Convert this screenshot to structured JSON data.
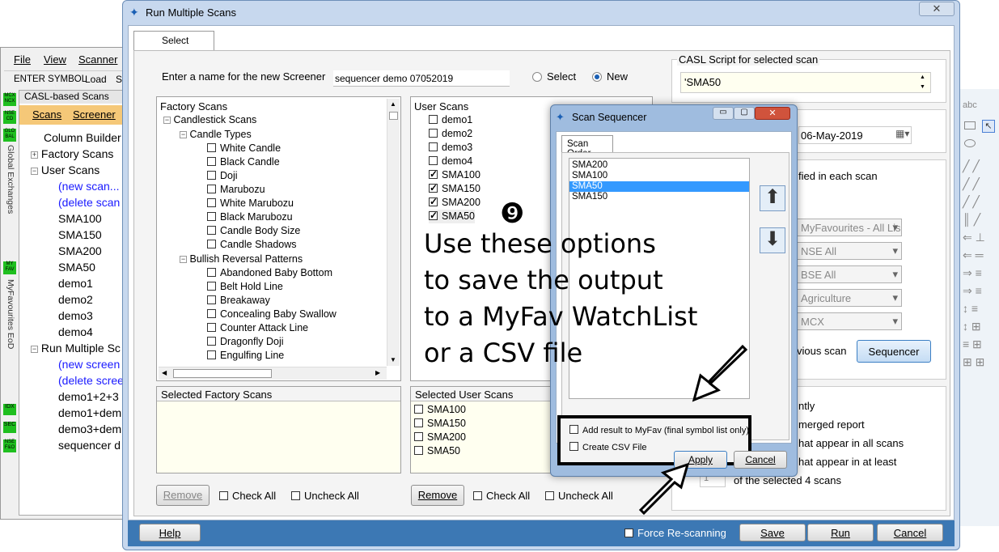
{
  "bg_app": {
    "menu": [
      "File",
      "View",
      "Scanner"
    ],
    "toolbar": [
      "ENTER SYMBOL",
      "Load",
      "Sc"
    ],
    "panel_title": "CASL-based Scans",
    "tabs": [
      "Scans",
      "Screener"
    ],
    "tree": [
      "Column Builder",
      "Factory Scans",
      "User Scans",
      "(new scan...",
      "(delete scan",
      "SMA100",
      "SMA150",
      "SMA200",
      "SMA50",
      "demo1",
      "demo2",
      "demo3",
      "demo4",
      "Run Multiple Sc",
      "(new screen",
      "(delete scree",
      "demo1+2+3",
      "demo1+dem",
      "demo3+dem",
      "sequencer d"
    ],
    "side_labels": [
      "Global Exchanges",
      "MyFavourites EoD"
    ],
    "side_badges": [
      "MCX NCX",
      "NSE CD",
      "GLO BAL",
      "MY FAV",
      "IDX",
      "SEC",
      "NSE F&O"
    ]
  },
  "window": {
    "title": "Run Multiple Scans",
    "tab": "Select"
  },
  "screener": {
    "name_label": "Enter a name for the new Screener",
    "name_value": "sequencer demo 07052019",
    "opt_select": "Select",
    "opt_new": "New"
  },
  "factory": {
    "header": "Factory Scans",
    "items": [
      "Candlestick Scans",
      "Candle Types",
      "White Candle",
      "Black Candle",
      "Doji",
      "Marubozu",
      "White Marubozu",
      "Black Marubozu",
      "Candle Body Size",
      "Candle Shadows",
      "Bullish Reversal Patterns",
      "Abandoned Baby Bottom",
      "Belt Hold Line",
      "Breakaway",
      "Concealing Baby Swallow",
      "Counter Attack Line",
      "Dragonfly Doji",
      "Engulfing Line"
    ]
  },
  "user_scans": {
    "header": "User Scans",
    "items": [
      "demo1",
      "demo2",
      "demo3",
      "demo4",
      "SMA100",
      "SMA150",
      "SMA200",
      "SMA50"
    ]
  },
  "sel_factory": {
    "header": "Selected Factory Scans",
    "remove": "Remove",
    "check_all": "Check All",
    "uncheck_all": "Uncheck All"
  },
  "sel_user": {
    "header": "Selected User Scans",
    "items": [
      "SMA100",
      "SMA150",
      "SMA200",
      "SMA50"
    ],
    "remove": "Remove",
    "check_all": "Check All",
    "uncheck_all": "Uncheck All"
  },
  "right": {
    "casl_label": "CASL Script for selected scan",
    "casl_value": "'SMA50",
    "date": "06-May-2019",
    "fied": "fied in each scan",
    "combos": [
      "MyFavourites - All Lis",
      "NSE All",
      "BSE All",
      "Agriculture",
      "MCX"
    ],
    "vious": "vious scan",
    "sequencer": "Sequencer",
    "opt1": "ntly",
    "opt2": "merged report",
    "opt3": "hat appear in all scans",
    "opt4": "hat appear in at least",
    "count": "1",
    "of_selected": "of the selected 4 scans"
  },
  "bottom": {
    "help": "Help",
    "force": "Force Re-scanning",
    "save": "Save",
    "run": "Run",
    "cancel": "Cancel"
  },
  "sequencer": {
    "title": "Scan Sequencer",
    "tab": "Scan Order",
    "items": [
      "SMA200",
      "SMA100",
      "SMA50",
      "SMA150"
    ],
    "selected_index": 2,
    "myfav": "Add result to MyFav (final symbol list only)",
    "csv": "Create CSV File",
    "apply": "Apply",
    "cancel": "Cancel"
  },
  "annotation": {
    "number": "❾",
    "lines": [
      "Use these options",
      "to save the output",
      "to a MyFav WatchList",
      "or a CSV file"
    ]
  },
  "colors": {
    "title_bg": "#c7d8ee",
    "accent": "#1a5fb4",
    "bottom_bar": "#3c78b4",
    "note_bg": "#fffff0"
  }
}
